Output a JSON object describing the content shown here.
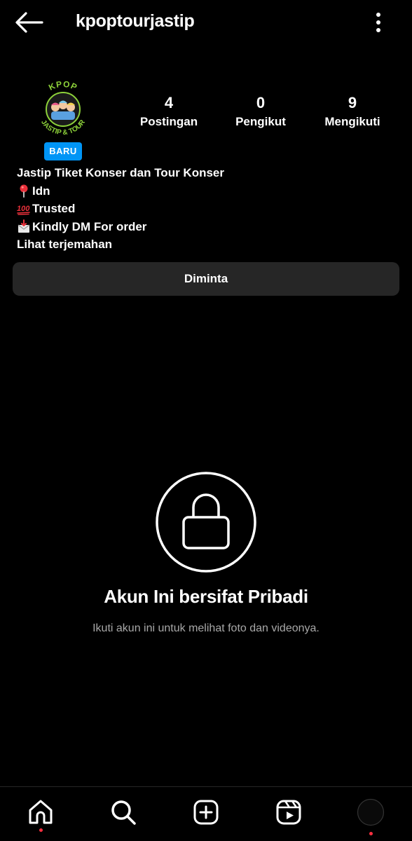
{
  "header": {
    "username": "kpoptourjastip",
    "back_icon": "arrow-left-icon",
    "more_icon": "more-vertical-icon"
  },
  "profile": {
    "avatar_text_top": "KPOP",
    "avatar_text_bottom": "JASTIP & TOUR",
    "badge": "BARU",
    "stats": [
      {
        "num": "4",
        "label": "Postingan"
      },
      {
        "num": "0",
        "label": "Pengikut"
      },
      {
        "num": "9",
        "label": "Mengikuti"
      }
    ]
  },
  "bio": {
    "line1": "Jastip Tiket Konser dan Tour Konser",
    "line2": "Idn",
    "line3": "Trusted",
    "line4": "Kindly DM For order",
    "translate": "Lihat terjemahan"
  },
  "actions": {
    "requested": "Diminta"
  },
  "private": {
    "title": "Akun Ini bersifat Pribadi",
    "subtitle": "Ikuti akun ini untuk melihat foto dan videonya."
  },
  "nav": {
    "items": [
      "home-icon",
      "search-icon",
      "create-icon",
      "reels-icon",
      "profile-avatar"
    ]
  },
  "colors": {
    "accent": "#0095f6",
    "button_bg": "#262626",
    "notification_dot": "#ff3040"
  }
}
